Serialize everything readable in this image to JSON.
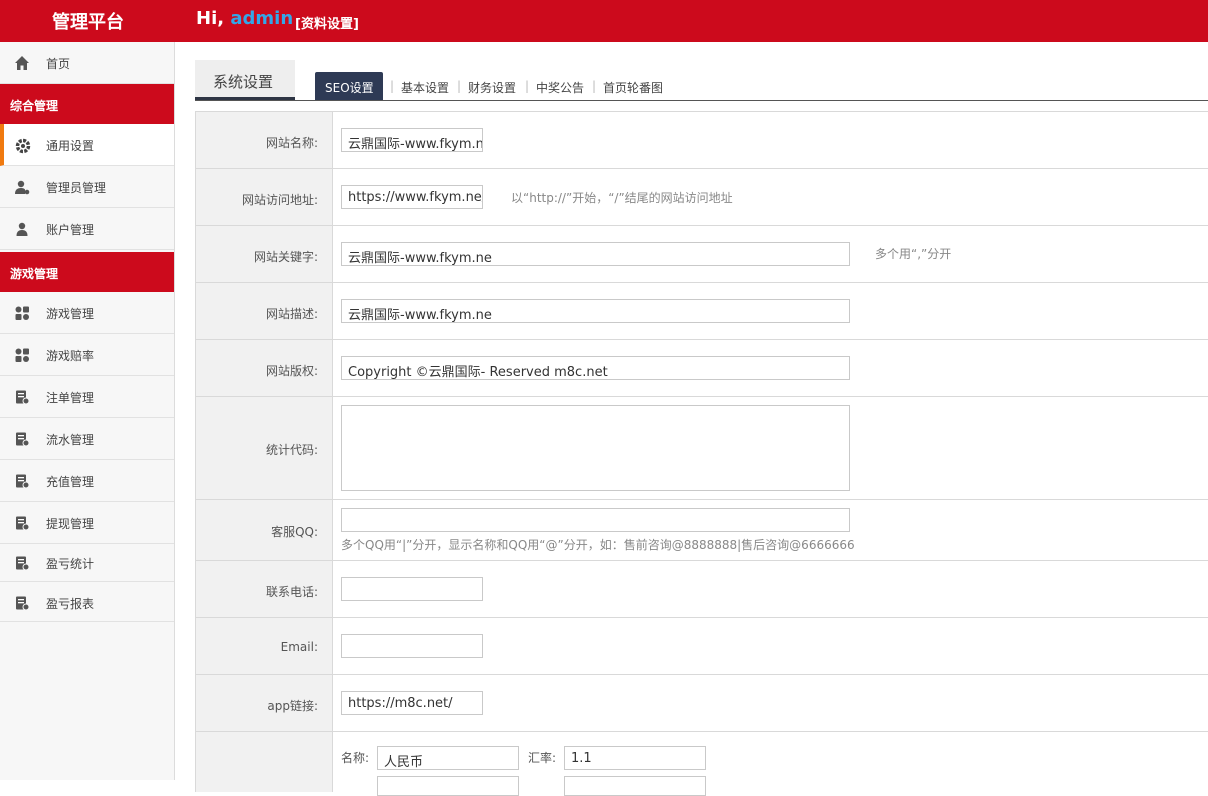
{
  "header": {
    "brand": "管理平台",
    "greeting": "Hi,",
    "username": "admin",
    "profile_link": "[资料设置]"
  },
  "sidebar": {
    "home": "首页",
    "group1": "综合管理",
    "general_settings": "通用设置",
    "admin_manage": "管理员管理",
    "account_manage": "账户管理",
    "group2": "游戏管理",
    "game_manage": "游戏管理",
    "game_odds": "游戏赔率",
    "bet_manage": "注单管理",
    "flow_manage": "流水管理",
    "recharge_manage": "充值管理",
    "withdraw_manage": "提现管理",
    "profit_stats": "盈亏统计",
    "profit_report": "盈亏报表"
  },
  "tabs": {
    "main": "系统设置",
    "seo": "SEO设置",
    "basic": "基本设置",
    "finance": "财务设置",
    "notice": "中奖公告",
    "banner": "首页轮番图",
    "separator": "|"
  },
  "form": {
    "site_name_label": "网站名称:",
    "site_name_value": "云鼎国际-www.fkym.ne",
    "site_url_label": "网站访问地址:",
    "site_url_value": "https://www.fkym.ne/",
    "site_url_hint": "以“http://”开始，“/”结尾的网站访问地址",
    "keywords_label": "网站关键字:",
    "keywords_value": "云鼎国际-www.fkym.ne",
    "keywords_hint": "多个用“,”分开",
    "description_label": "网站描述:",
    "description_value": "云鼎国际-www.fkym.ne",
    "copyright_label": "网站版权:",
    "copyright_value": "Copyright ©云鼎国际- Reserved m8c.net",
    "stats_code_label": "统计代码:",
    "stats_code_value": "",
    "qq_label": "客服QQ:",
    "qq_value": "",
    "qq_hint": "多个QQ用“|”分开，显示名称和QQ用“@”分开，如：售前咨询@8888888|售后咨询@6666666",
    "phone_label": "联系电话:",
    "phone_value": "",
    "email_label": "Email:",
    "email_value": "",
    "app_label": "app链接:",
    "app_value": "https://m8c.net/",
    "currency_name_label": "名称:",
    "currency_name_value": "人民币",
    "currency_rate_label": "汇率:",
    "currency_rate_value": "1.1"
  },
  "colors": {
    "brand_red": "#cc0a1c",
    "username_blue": "#33a6e8",
    "active_tab": "#2e3a55",
    "active_accent": "#f07a10"
  }
}
